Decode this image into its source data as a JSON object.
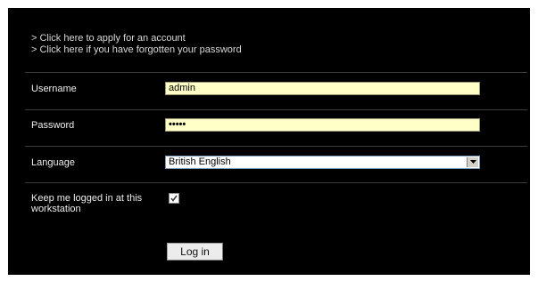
{
  "links": {
    "apply": "> Click here to apply for an account",
    "forgot": "> Click here if you have forgotten your password"
  },
  "form": {
    "username_label": "Username",
    "username_value": "admin",
    "password_label": "Password",
    "password_mask": "•••••",
    "language_label": "Language",
    "language_value": "British English",
    "remember_label_line1": "Keep me logged in at this",
    "remember_label_line2": "workstation",
    "remember_checked": true,
    "login_label": "Log in"
  },
  "colors": {
    "background": "#000000",
    "input_fill": "#ffffc8",
    "divider": "#3b3b3b"
  },
  "icons": {
    "select_arrow": "chevron-down-icon",
    "checkbox_mark": "checkmark-icon"
  }
}
